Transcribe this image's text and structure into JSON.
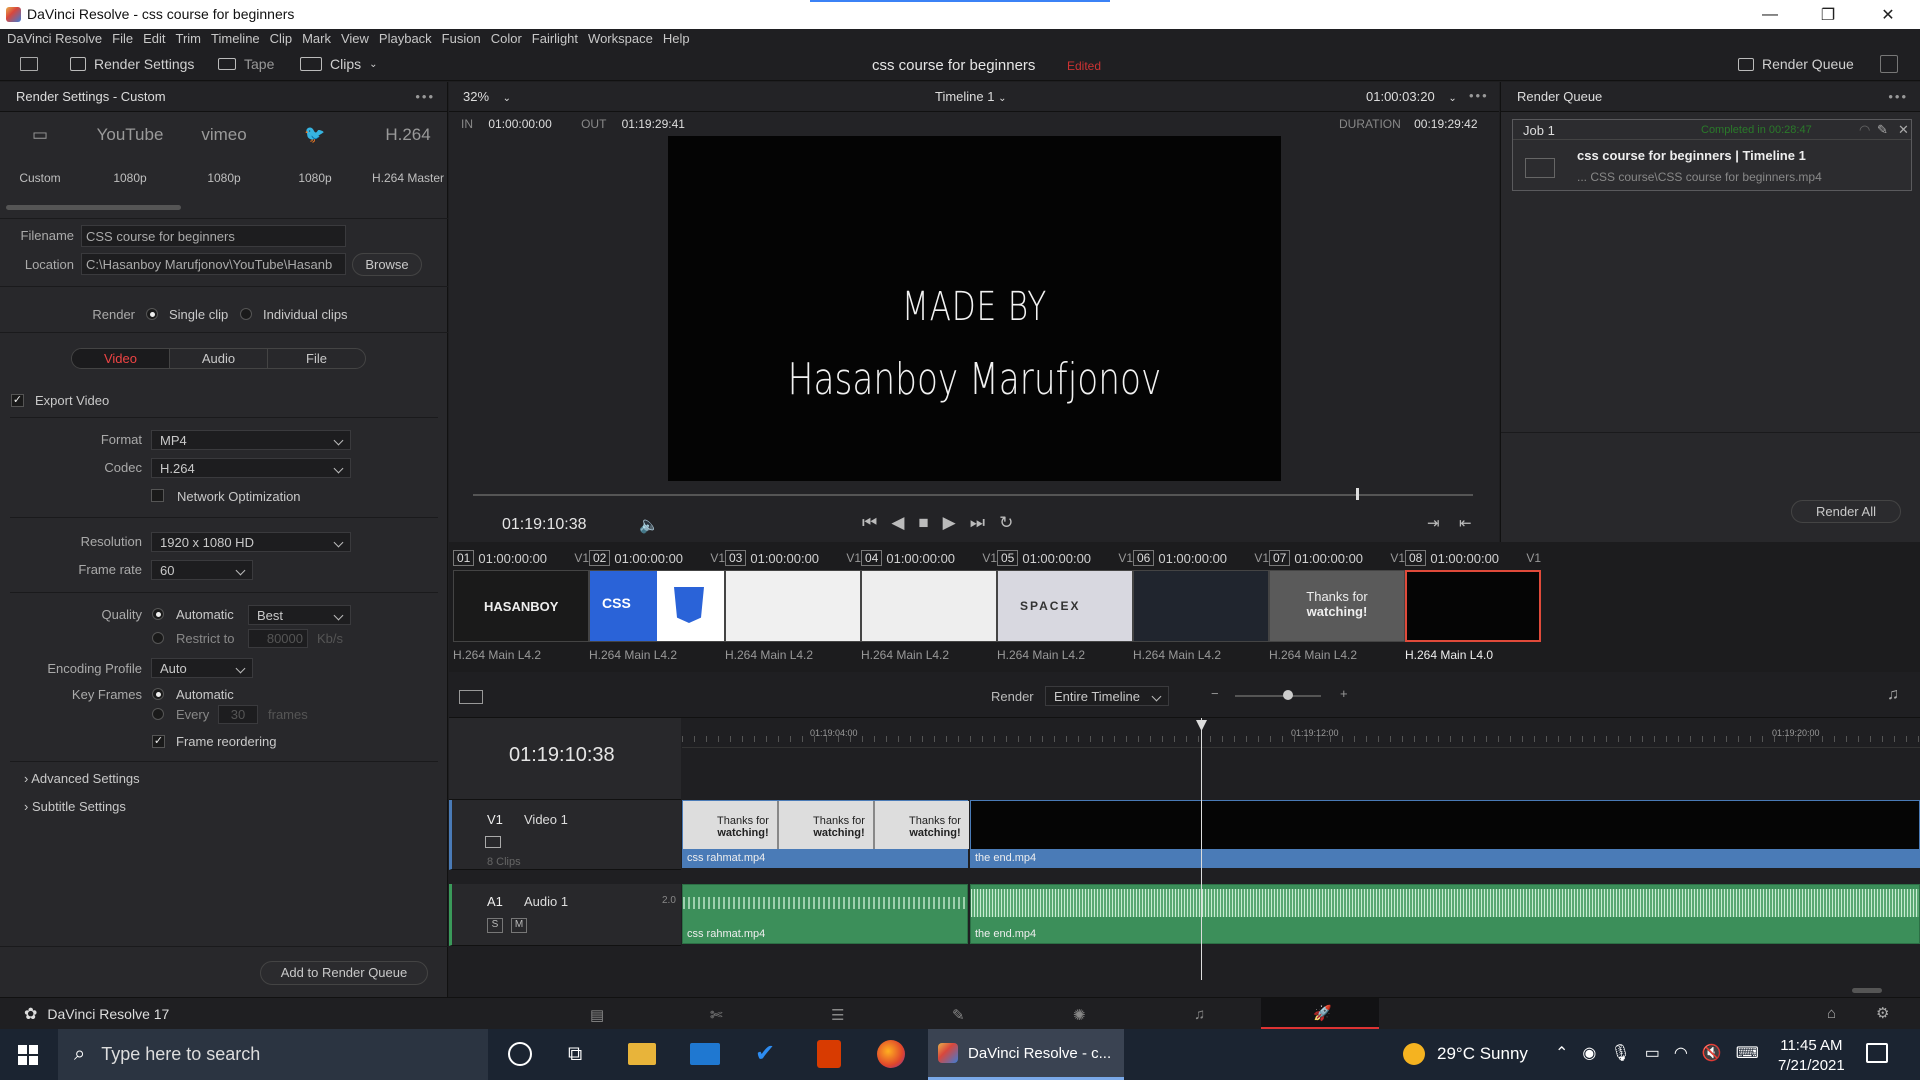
{
  "window": {
    "title": "DaVinci Resolve - css course for beginners",
    "minimize": "—",
    "restore": "❐",
    "close": "✕"
  },
  "menu": [
    "DaVinci Resolve",
    "File",
    "Edit",
    "Trim",
    "Timeline",
    "Clip",
    "Mark",
    "View",
    "Playback",
    "Fusion",
    "Color",
    "Fairlight",
    "Workspace",
    "Help"
  ],
  "toolbar": {
    "render_settings": "Render Settings",
    "tape": "Tape",
    "clips": "Clips",
    "project_name": "css course for beginners",
    "edited": "Edited",
    "render_queue": "Render Queue"
  },
  "render_settings": {
    "header": "Render Settings - Custom",
    "presets": [
      {
        "logo": "▭",
        "label": "Custom"
      },
      {
        "logo": "YouTube",
        "label": "1080p"
      },
      {
        "logo": "vimeo",
        "label": "1080p"
      },
      {
        "logo": "🐦",
        "label": "1080p"
      },
      {
        "logo": "H.264",
        "label": "H.264 Master"
      }
    ],
    "filename_label": "Filename",
    "filename": "CSS course for beginners",
    "location_label": "Location",
    "location": "C:\\Hasanboy Marufjonov\\YouTube\\Hasanb",
    "browse": "Browse",
    "render_label": "Render",
    "single_clip": "Single clip",
    "individual_clips": "Individual clips",
    "tabs": [
      "Video",
      "Audio",
      "File"
    ],
    "export_video": "Export Video",
    "format_label": "Format",
    "format": "MP4",
    "codec_label": "Codec",
    "codec": "H.264",
    "network_opt": "Network Optimization",
    "resolution_label": "Resolution",
    "resolution": "1920 x 1080 HD",
    "framerate_label": "Frame rate",
    "framerate": "60",
    "quality_label": "Quality",
    "automatic": "Automatic",
    "quality": "Best",
    "restrict_to": "Restrict to",
    "restrict_value": "80000",
    "kbs": "Kb/s",
    "encoding_profile_label": "Encoding Profile",
    "encoding_profile": "Auto",
    "key_frames_label": "Key Frames",
    "key_automatic": "Automatic",
    "every": "Every",
    "every_value": "30",
    "frames": "frames",
    "frame_reordering": "Frame reordering",
    "advanced": "Advanced Settings",
    "subtitle": "Subtitle Settings",
    "add_queue": "Add to Render Queue"
  },
  "viewer": {
    "zoom": "32%",
    "timeline_name": "Timeline 1",
    "timecode": "01:00:03:20",
    "in_label": "IN",
    "in": "01:00:00:00",
    "out_label": "OUT",
    "out": "01:19:29:41",
    "duration_label": "DURATION",
    "duration": "00:19:29:42",
    "line1": "MADE BY",
    "line2": "Hasanboy Marufjonov",
    "playhead_tc": "01:19:10:38"
  },
  "render_queue": {
    "header": "Render Queue",
    "job": "Job 1",
    "status": "Completed in 00:28:47",
    "title": "css course for beginners | Timeline 1",
    "path": "... CSS course\\CSS course for beginners.mp4",
    "render_all": "Render All"
  },
  "clips": [
    {
      "num": "01",
      "tc": "01:00:00:00",
      "track": "V1",
      "codec": "H.264 Main L4.2"
    },
    {
      "num": "02",
      "tc": "01:00:00:00",
      "track": "V1",
      "codec": "H.264 Main L4.2"
    },
    {
      "num": "03",
      "tc": "01:00:00:00",
      "track": "V1",
      "codec": "H.264 Main L4.2"
    },
    {
      "num": "04",
      "tc": "01:00:00:00",
      "track": "V1",
      "codec": "H.264 Main L4.2"
    },
    {
      "num": "05",
      "tc": "01:00:00:00",
      "track": "V1",
      "codec": "H.264 Main L4.2"
    },
    {
      "num": "06",
      "tc": "01:00:00:00",
      "track": "V1",
      "codec": "H.264 Main L4.2"
    },
    {
      "num": "07",
      "tc": "01:00:00:00",
      "track": "V1",
      "codec": "H.264 Main L4.2"
    },
    {
      "num": "08",
      "tc": "01:00:00:00",
      "track": "V1",
      "codec": "H.264 Main L4.0"
    }
  ],
  "thumb_text": {
    "c1": "HASANBOY",
    "c2": "CSS",
    "c5": "SPACEX",
    "c7a": "Thanks for",
    "c7b": "watching!"
  },
  "timeline": {
    "render_label": "Render",
    "render_range": "Entire Timeline",
    "timecode": "01:19:10:38",
    "ruler": [
      "01:19:04:00",
      "01:19:12:00",
      "01:19:20:00"
    ],
    "v1": "V1",
    "video1": "Video 1",
    "clip_count": "8 Clips",
    "a1": "A1",
    "audio1": "Audio 1",
    "audio_level": "2.0",
    "solo": "S",
    "mute": "M",
    "clip_a": "css rahmat.mp4",
    "clip_b": "the end.mp4",
    "thanks1": "Thanks for",
    "thanks2": "watching!"
  },
  "pagebar": {
    "app": "DaVinci Resolve 17"
  },
  "taskbar": {
    "search": "Type here to search",
    "active_app": "DaVinci Resolve - c...",
    "weather": "29°C  Sunny",
    "time": "11:45 AM",
    "date": "7/21/2021"
  }
}
